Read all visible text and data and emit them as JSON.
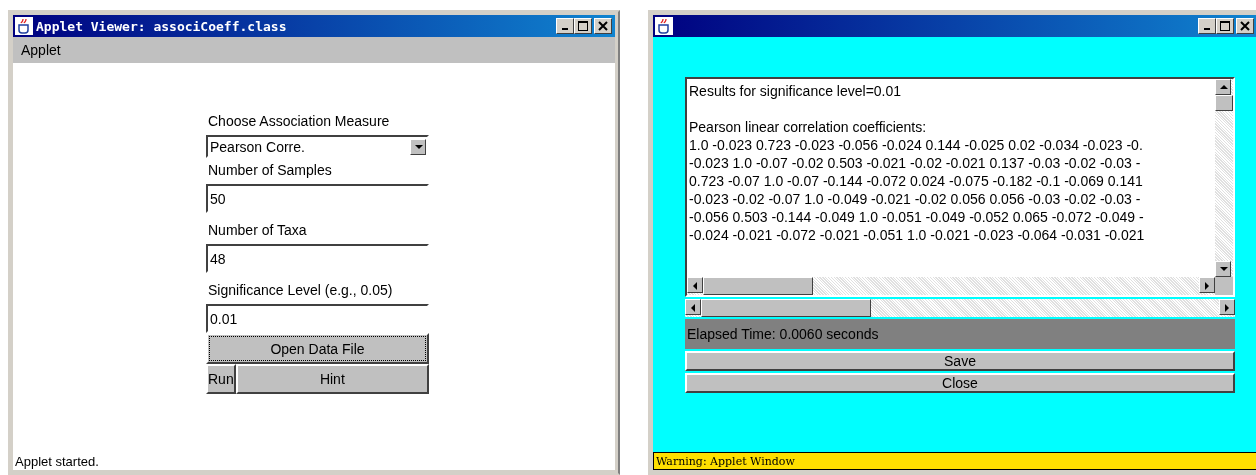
{
  "applet_window": {
    "title": "Applet Viewer: associCoeff.class",
    "menu": [
      "Applet"
    ],
    "form": {
      "measure_label": "Choose Association Measure",
      "measure_value": "Pearson Corre.",
      "fields": [
        {
          "label": "Number of Samples",
          "value": "50"
        },
        {
          "label": "Number of Taxa",
          "value": "48"
        },
        {
          "label": "Significance Level (e.g., 0.05)",
          "value": "0.01"
        }
      ],
      "open_button": "Open Data File",
      "run_button": "Run",
      "hint_button": "Hint"
    },
    "status": "Applet started."
  },
  "results_window": {
    "heading": "Results for significance level=0.01",
    "lines": [
      "Pearson linear correlation coefficients:",
      "1.0 -0.023 0.723 -0.023 -0.056 -0.024 0.144 -0.025 0.02 -0.034 -0.023 -0.",
      "-0.023 1.0 -0.07 -0.02 0.503 -0.021 -0.02 -0.021 0.137 -0.03 -0.02 -0.03 -",
      "0.723 -0.07 1.0 -0.07 -0.144 -0.072 0.024 -0.075 -0.182 -0.1 -0.069 0.141",
      "-0.023 -0.02 -0.07 1.0 -0.049 -0.021 -0.02 0.056 0.056 -0.03 -0.02 -0.03 -",
      "-0.056 0.503 -0.144 -0.049 1.0 -0.051 -0.049 -0.052 0.065 -0.072 -0.049 -",
      "-0.024 -0.021 -0.072 -0.021 -0.051 1.0 -0.021 -0.023 -0.064 -0.031 -0.021"
    ],
    "elapsed": "Elapsed Time: 0.0060 seconds",
    "save_button": "Save",
    "close_button": "Close",
    "warning": "Warning: Applet Window"
  }
}
